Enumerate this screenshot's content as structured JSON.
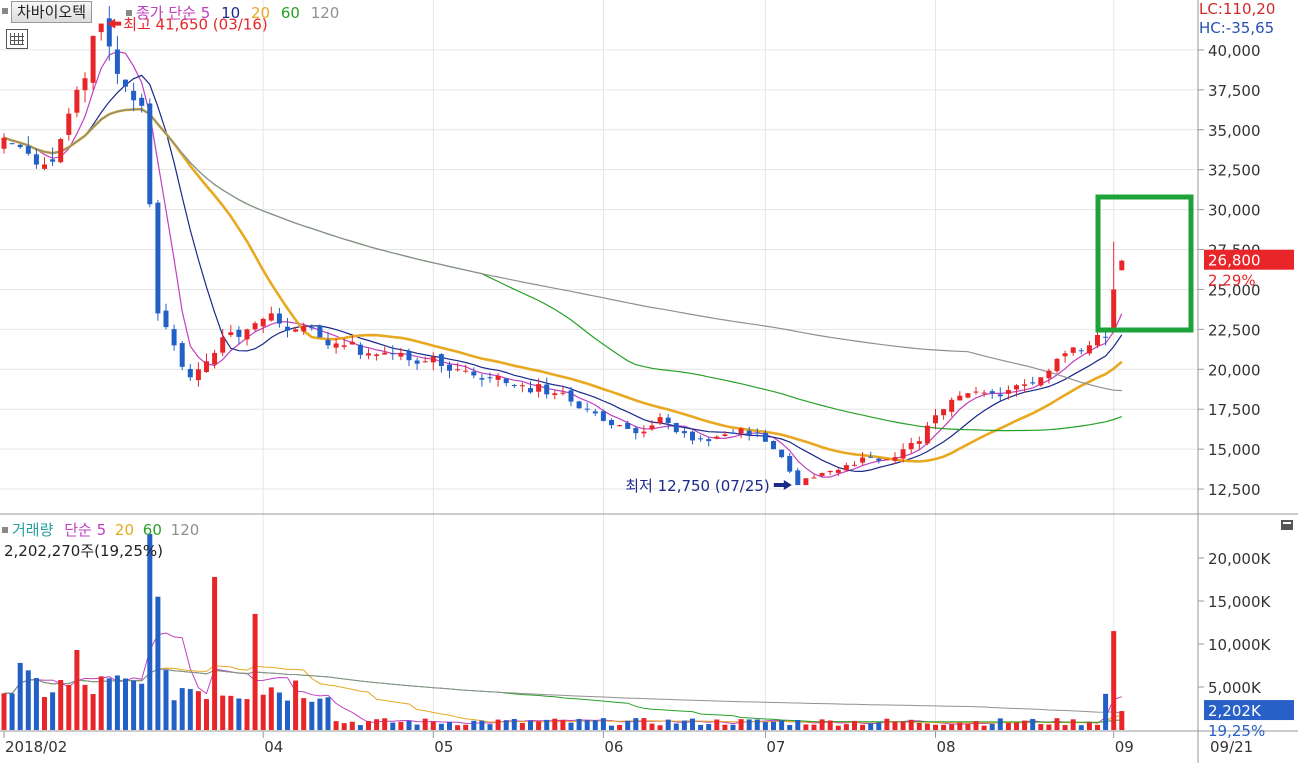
{
  "header": {
    "stock_name": "차바이오텍",
    "ma_label": "종가 단순",
    "ma_periods": [
      "5",
      "10",
      "20",
      "60",
      "120"
    ],
    "lc": "LC:110,20",
    "hc": "HC:-35,65"
  },
  "volume_header": {
    "title": "거래량",
    "ma_label": "단순",
    "ma_periods": [
      "5",
      "20",
      "60",
      "120"
    ],
    "current": "2,202,270주(19,25%)"
  },
  "annotations": {
    "high": "최고 41,650 (03/16)",
    "low": "최저 12,750 (07/25)"
  },
  "price_badge": {
    "price": "26,800",
    "change": "2,29%"
  },
  "volume_badge": {
    "volume": "2,202K",
    "change": "19,25%"
  },
  "colors": {
    "up": "#e8262a",
    "down": "#2260c8",
    "ma5": "#c040c0",
    "ma10": "#1a2a8a",
    "ma20": "#e8a820",
    "ma60": "#28a028",
    "ma120": "#909090",
    "highlight": "#1ea33a",
    "grid": "#e6e6e6"
  },
  "chart_data": [
    {
      "type": "candlestick",
      "title": "차바이오텍",
      "x_ticks": [
        "2018/02",
        "04",
        "05",
        "06",
        "07",
        "08",
        "09",
        "09/21"
      ],
      "y_ticks": [
        "12,500",
        "15,000",
        "17,500",
        "20,000",
        "22,500",
        "25,000",
        "27,500",
        "30,000",
        "32,500",
        "35,000",
        "37,500",
        "40,000"
      ],
      "ylim": [
        11000,
        42500
      ],
      "months": [
        {
          "label": "2018/02",
          "start": 0
        },
        {
          "label": "04",
          "start": 32
        },
        {
          "label": "05",
          "start": 53
        },
        {
          "label": "06",
          "start": 74
        },
        {
          "label": "07",
          "start": 94
        },
        {
          "label": "08",
          "start": 115
        },
        {
          "label": "09",
          "start": 137
        }
      ],
      "anchors": [
        [
          0,
          34500
        ],
        [
          3,
          33500
        ],
        [
          6,
          33000
        ],
        [
          9,
          37500
        ],
        [
          12,
          41650
        ],
        [
          14,
          38500
        ],
        [
          17,
          36500
        ],
        [
          19,
          23500
        ],
        [
          21,
          21500
        ],
        [
          23,
          19500
        ],
        [
          25,
          20500
        ],
        [
          27,
          22000
        ],
        [
          30,
          22500
        ],
        [
          33,
          23500
        ],
        [
          36,
          22500
        ],
        [
          39,
          22000
        ],
        [
          42,
          21500
        ],
        [
          45,
          21000
        ],
        [
          48,
          21000
        ],
        [
          52,
          20500
        ],
        [
          56,
          20000
        ],
        [
          60,
          19500
        ],
        [
          64,
          19000
        ],
        [
          68,
          18500
        ],
        [
          72,
          17500
        ],
        [
          75,
          16500
        ],
        [
          78,
          16000
        ],
        [
          81,
          17000
        ],
        [
          84,
          16000
        ],
        [
          87,
          15500
        ],
        [
          90,
          16000
        ],
        [
          93,
          16000
        ],
        [
          96,
          14500
        ],
        [
          98,
          12750
        ],
        [
          101,
          13500
        ],
        [
          104,
          14000
        ],
        [
          107,
          14500
        ],
        [
          110,
          14500
        ],
        [
          113,
          15500
        ],
        [
          116,
          17500
        ],
        [
          119,
          18500
        ],
        [
          122,
          18500
        ],
        [
          125,
          19000
        ],
        [
          128,
          19500
        ],
        [
          131,
          21000
        ],
        [
          134,
          21500
        ],
        [
          136,
          22000
        ],
        [
          137,
          25000
        ],
        [
          138,
          26800
        ]
      ],
      "high": {
        "value": 41650,
        "date": "03/16"
      },
      "low": {
        "value": 12750,
        "date": "07/25"
      },
      "last": {
        "value": 26800,
        "change_pct": 2.29
      },
      "moving_averages": [
        "5",
        "10",
        "20",
        "60",
        "120"
      ],
      "highlight": "last two sessions"
    },
    {
      "type": "bar",
      "title": "거래량",
      "y_ticks": [
        "5,000K",
        "10,000K",
        "15,000K",
        "20,000K"
      ],
      "ylim": [
        0,
        25000
      ],
      "unit": "K",
      "last": {
        "value": 2202,
        "change_pct": 19.25
      },
      "spikes_k": [
        {
          "index": 2,
          "value": 7800
        },
        {
          "index": 9,
          "value": 9300
        },
        {
          "index": 18,
          "value": 22800
        },
        {
          "index": 19,
          "value": 15500
        },
        {
          "index": 26,
          "value": 17800
        },
        {
          "index": 31,
          "value": 13500
        },
        {
          "index": 40,
          "value": 3800
        },
        {
          "index": 136,
          "value": 4200
        },
        {
          "index": 137,
          "value": 11500
        },
        {
          "index": 138,
          "value": 2202
        }
      ],
      "moving_averages": [
        "5",
        "20",
        "60",
        "120"
      ]
    }
  ]
}
